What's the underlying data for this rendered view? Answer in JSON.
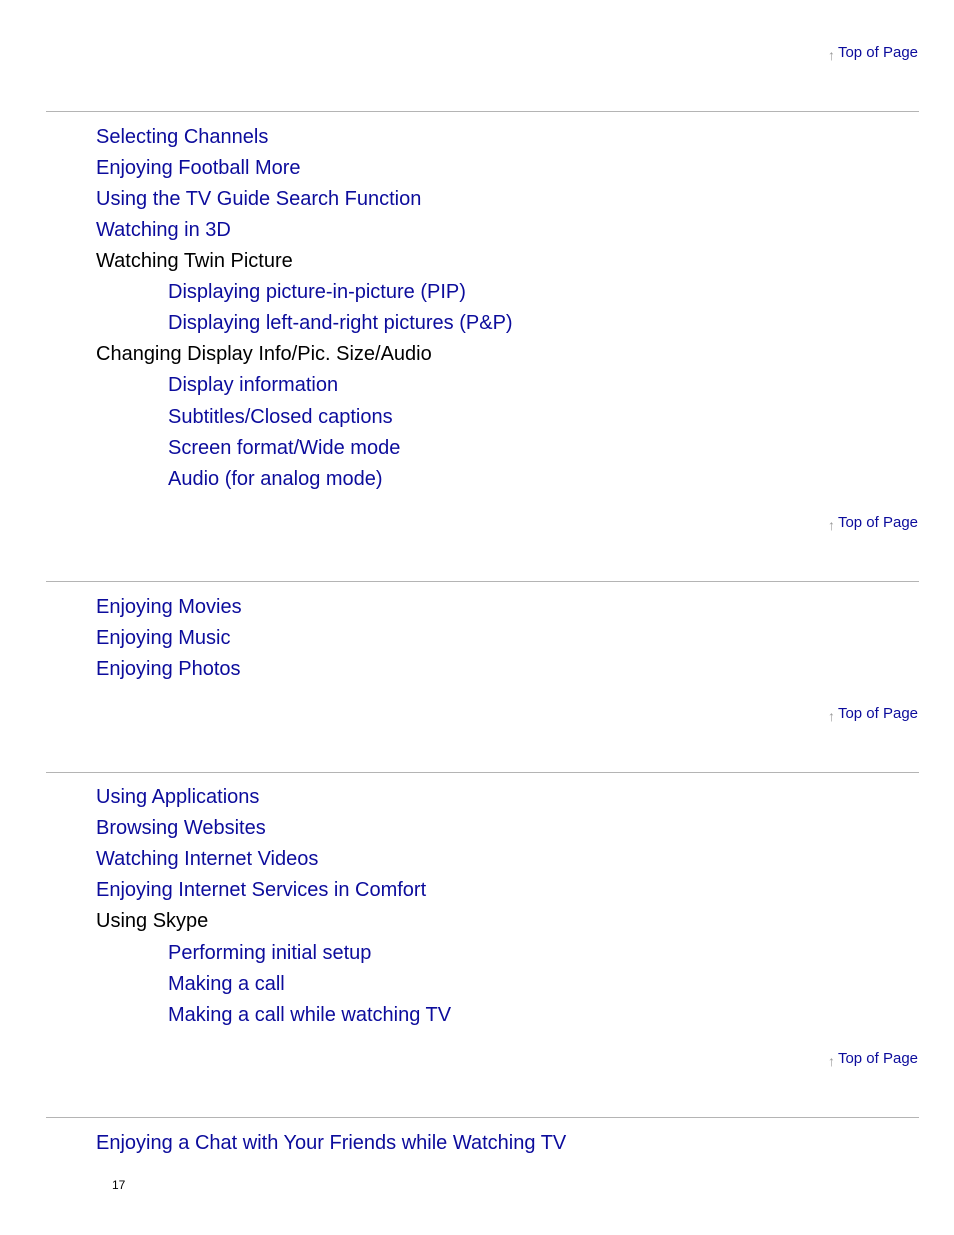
{
  "top_of_page_label": "Top of Page",
  "arrow_glyph": "↑",
  "sections": [
    {
      "items": [
        {
          "label": "Selecting Channels",
          "level": 1,
          "link": true
        },
        {
          "label": "Enjoying Football More",
          "level": 1,
          "link": true
        },
        {
          "label": "Using the TV Guide Search Function",
          "level": 1,
          "link": true
        },
        {
          "label": "Watching in 3D",
          "level": 1,
          "link": true
        },
        {
          "label": "Watching Twin Picture",
          "level": 1,
          "link": false
        },
        {
          "label": "Displaying picture-in-picture (PIP)",
          "level": 2,
          "link": true
        },
        {
          "label": "Displaying left-and-right pictures (P&P)",
          "level": 2,
          "link": true
        },
        {
          "label": "Changing Display Info/Pic. Size/Audio",
          "level": 1,
          "link": false
        },
        {
          "label": "Display information",
          "level": 2,
          "link": true
        },
        {
          "label": "Subtitles/Closed captions",
          "level": 2,
          "link": true
        },
        {
          "label": "Screen format/Wide mode",
          "level": 2,
          "link": true
        },
        {
          "label": "Audio (for analog mode)",
          "level": 2,
          "link": true
        }
      ]
    },
    {
      "items": [
        {
          "label": "Enjoying Movies",
          "level": 1,
          "link": true
        },
        {
          "label": "Enjoying Music",
          "level": 1,
          "link": true
        },
        {
          "label": "Enjoying Photos",
          "level": 1,
          "link": true
        }
      ]
    },
    {
      "items": [
        {
          "label": "Using Applications",
          "level": 1,
          "link": true
        },
        {
          "label": "Browsing Websites",
          "level": 1,
          "link": true
        },
        {
          "label": "Watching Internet Videos",
          "level": 1,
          "link": true
        },
        {
          "label": "Enjoying Internet Services in Comfort",
          "level": 1,
          "link": true
        },
        {
          "label": "Using Skype",
          "level": 1,
          "link": false
        },
        {
          "label": "Performing initial setup",
          "level": 2,
          "link": true
        },
        {
          "label": "Making a call",
          "level": 2,
          "link": true
        },
        {
          "label": "Making a call while watching TV",
          "level": 2,
          "link": true
        }
      ]
    },
    {
      "items": [
        {
          "label": "Enjoying a Chat with Your Friends while Watching TV",
          "level": 1,
          "link": true
        }
      ]
    }
  ],
  "page_number": "17",
  "colors": {
    "link": "#0c0c9c",
    "text": "#000000",
    "rule": "#b4b4b4",
    "arrow": "#999999"
  }
}
